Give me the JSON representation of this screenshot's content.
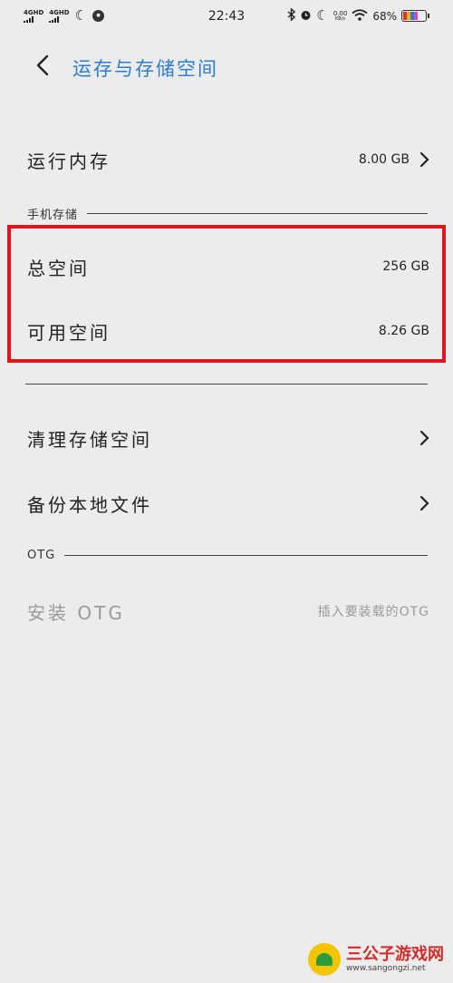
{
  "status_bar": {
    "signal1": "4GHD",
    "signal2": "4GHD",
    "time": "22:43",
    "net_speed": "0.00",
    "net_unit": "KB/s",
    "battery": "68%",
    "battery_level": 0.68
  },
  "header": {
    "title": "运存与存储空间"
  },
  "ram": {
    "label": "运行内存",
    "value": "8.00 GB"
  },
  "phone_storage": {
    "section_label": "手机存储",
    "total": {
      "label": "总空间",
      "value": "256 GB"
    },
    "available": {
      "label": "可用空间",
      "value": "8.26 GB"
    }
  },
  "actions": {
    "clean": "清理存储空间",
    "backup": "备份本地文件"
  },
  "otg": {
    "section_label": "OTG",
    "install_label": "安装 OTG",
    "install_hint": "插入要装载的OTG"
  },
  "watermark": {
    "main": "三公子游戏网",
    "sub": "www.sangongzi.net"
  },
  "colors": {
    "accent": "#2b7cd3",
    "highlight_box": "#e0141f",
    "background": "#ececec"
  }
}
